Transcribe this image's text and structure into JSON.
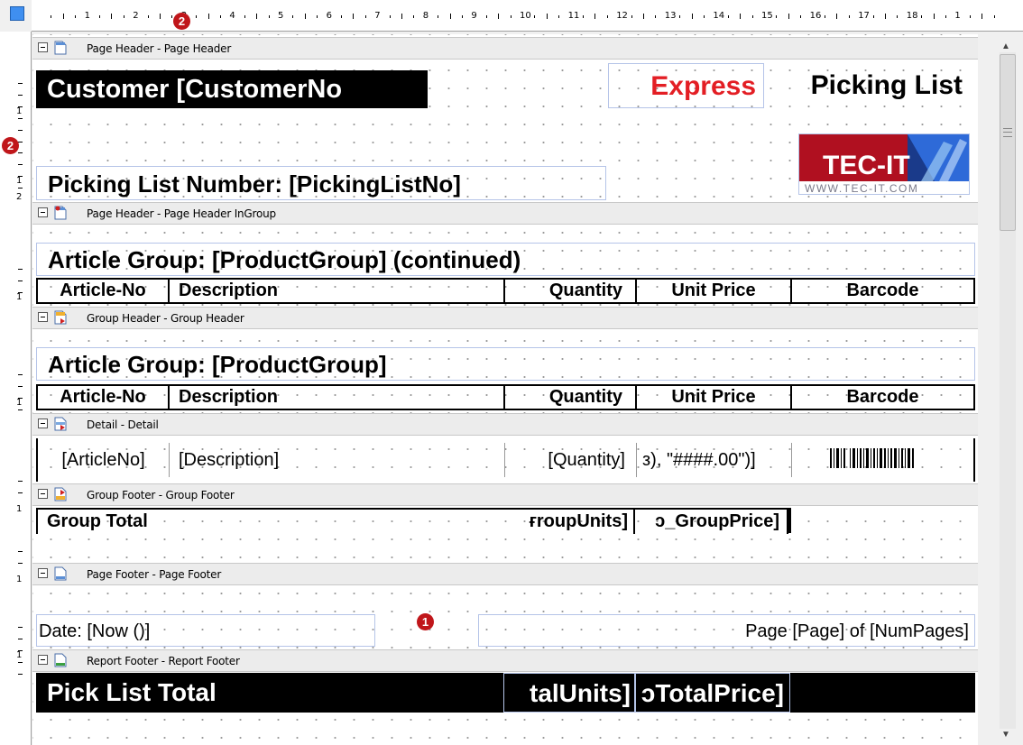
{
  "ruler": {
    "h_numbers": [
      "1",
      "2",
      "3",
      "4",
      "5",
      "6",
      "7",
      "8",
      "9",
      "10",
      "11",
      "12",
      "13",
      "14",
      "15",
      "16",
      "17",
      "18",
      "1"
    ],
    "v_groups": [
      [
        "1"
      ],
      [
        "1",
        "2"
      ],
      [
        "1"
      ],
      [
        "1"
      ],
      [
        "1"
      ],
      [
        "1"
      ],
      [
        "1"
      ]
    ]
  },
  "markers": {
    "one": "1",
    "two": "2"
  },
  "bands": {
    "page_header": "Page Header - Page Header",
    "page_header_ingroup": "Page Header - Page Header InGroup",
    "group_header": "Group Header - Group Header",
    "detail": "Detail - Detail",
    "group_footer": "Group Footer - Group Footer",
    "page_footer": "Page Footer - Page Footer",
    "report_footer": "Report Footer - Report Footer"
  },
  "page_header": {
    "customer": "Customer [CustomerNo",
    "express": "Express",
    "picking_list": "Picking List",
    "logo_text": "TEC-IT",
    "logo_url": "WWW.TEC-IT.COM",
    "picking_list_number": "Picking List Number: [PickingListNo]"
  },
  "ingroup": {
    "article_group": "Article Group: [ProductGroup] (continued)",
    "columns": [
      "Article-No",
      "Description",
      "Quantity",
      "Unit Price",
      "Barcode"
    ]
  },
  "group_header": {
    "article_group": "Article Group: [ProductGroup]",
    "columns": [
      "Article-No",
      "Description",
      "Quantity",
      "Unit Price",
      "Barcode"
    ]
  },
  "detail": {
    "article_no": "[ArticleNo]",
    "description": "[Description]",
    "quantity": "[Quantity]",
    "unit_price": "з), \"####.00\")]"
  },
  "group_footer": {
    "total_label": "Group Total",
    "units": "ғroupUnits]",
    "price": "ɔ_GroupPrice]"
  },
  "page_footer": {
    "date": "Date: [Now ()]",
    "page": "Page [Page] of [NumPages]"
  },
  "report_footer": {
    "total_label": "Pick List Total",
    "units": "talUnits]",
    "price": "ɔTotalPrice]"
  },
  "colors": {
    "express": "#e31e24",
    "logo_red": "#c8102e",
    "marker": "#c0161a",
    "ruler_corner": "#3f8ff0"
  }
}
